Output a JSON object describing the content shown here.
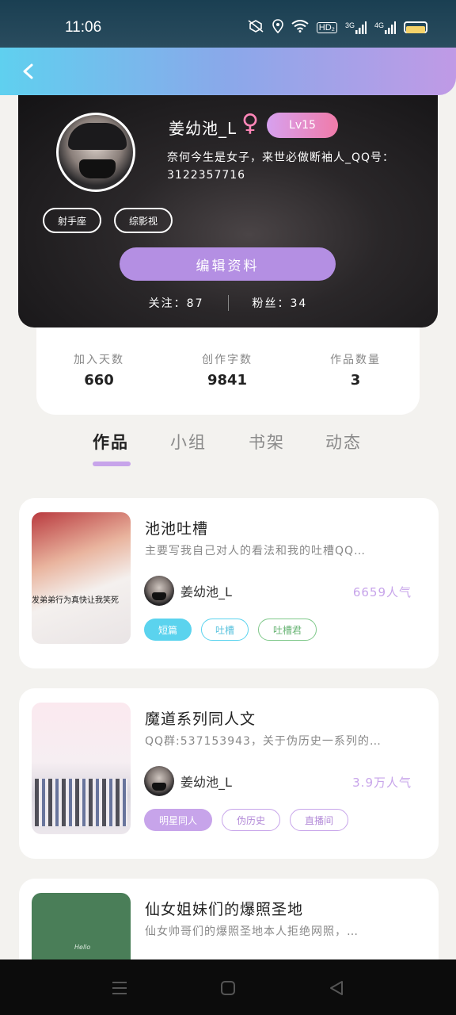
{
  "status_bar": {
    "time": "11:06",
    "network_labels": [
      "HD₂",
      "3G",
      "4G"
    ]
  },
  "header": {
    "back_icon": "chevron-left-icon"
  },
  "profile": {
    "username": "姜幼池_L",
    "gender_symbol": "♀",
    "level": "Lv15",
    "bio": "奈何今生是女子，来世必做断袖人_QQ号：3122357716",
    "tags": [
      "射手座",
      "综影视"
    ],
    "edit_button": "编辑资料",
    "following_label": "关注：87",
    "followers_label": "粉丝：34"
  },
  "stats": [
    {
      "label": "加入天数",
      "value": "660"
    },
    {
      "label": "创作字数",
      "value": "9841"
    },
    {
      "label": "作品数量",
      "value": "3"
    }
  ],
  "tabs": {
    "items": [
      "作品",
      "小组",
      "书架",
      "动态"
    ],
    "active_index": 0
  },
  "works": [
    {
      "title": "池池吐槽",
      "description": "主要写我自己对人的看法和我的吐槽QQ…",
      "author": "姜幼池_L",
      "popularity": "6659人气",
      "cover_caption": "发弟弟行为真快让我笑死",
      "tags": [
        "短篇",
        "吐槽",
        "吐槽君"
      ]
    },
    {
      "title": "魔道系列同人文",
      "description": "QQ群:537153943，关于伪历史一系列的…",
      "author": "姜幼池_L",
      "popularity": "3.9万人气",
      "tags": [
        "明星同人",
        "伪历史",
        "直播间"
      ]
    },
    {
      "title": "仙女姐妹们的爆照圣地",
      "description": "仙女帅哥们的爆照圣地本人拒绝网照，…",
      "cover_caption": "Hello"
    }
  ],
  "colors": {
    "accent_purple": "#c7a4ea",
    "accent_blue": "#5bd3ee",
    "accent_green": "#7fc88a"
  }
}
